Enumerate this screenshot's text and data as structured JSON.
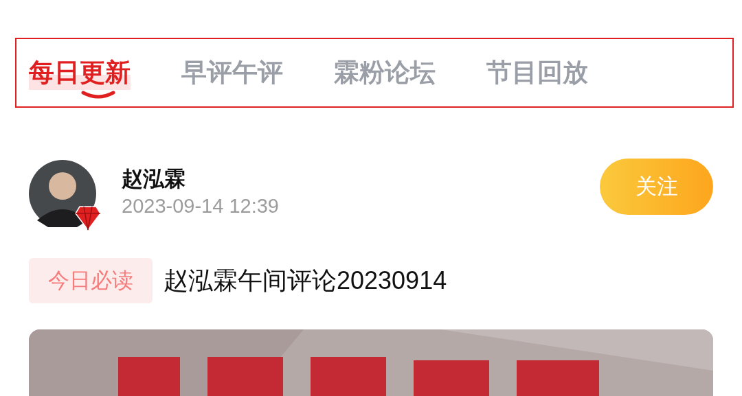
{
  "tabs": [
    {
      "label": "每日更新",
      "selected": true
    },
    {
      "label": "早评午评",
      "selected": false
    },
    {
      "label": "霖粉论坛",
      "selected": false
    },
    {
      "label": "节目回放",
      "selected": false
    }
  ],
  "post": {
    "author": "赵泓霖",
    "time": "2023-09-14 12:39",
    "follow_button": "关注",
    "tag": "今日必读",
    "title": "赵泓霖午间评论20230914"
  }
}
